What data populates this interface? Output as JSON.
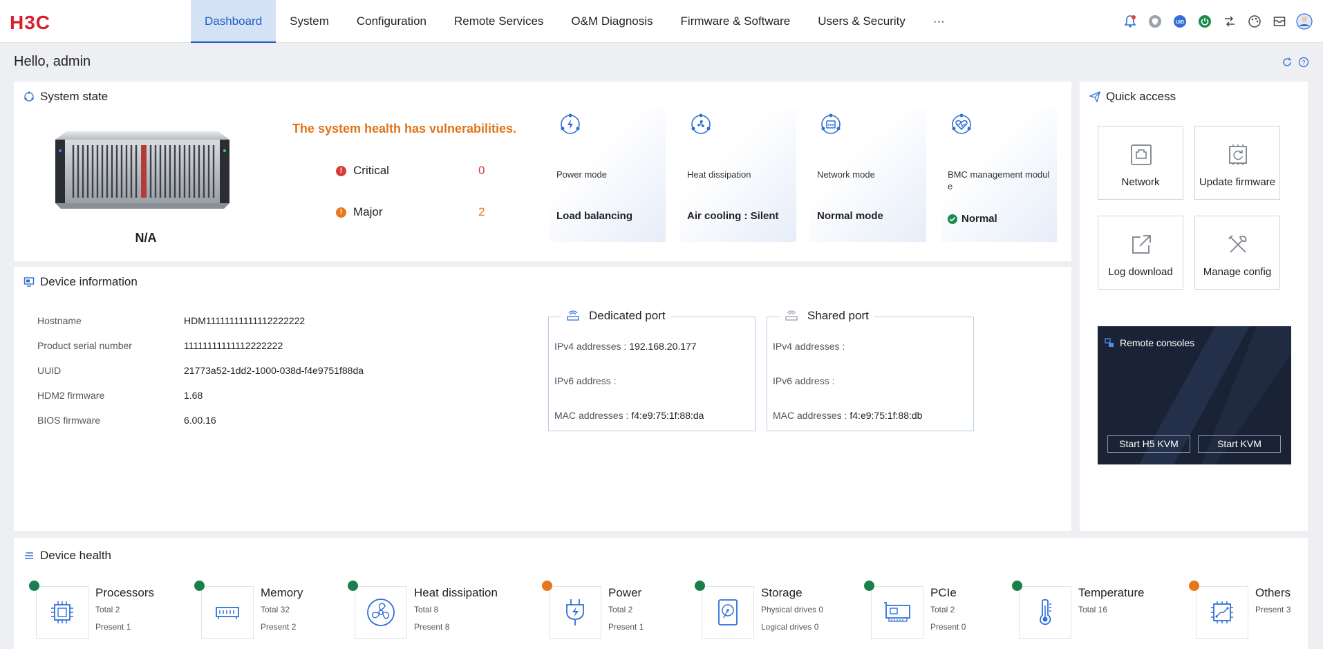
{
  "brand": {
    "logo_text": "H3C",
    "logo_color": "#d81e2c"
  },
  "nav": {
    "items": [
      {
        "label": "Dashboard",
        "active": true
      },
      {
        "label": "System"
      },
      {
        "label": "Configuration"
      },
      {
        "label": "Remote Services"
      },
      {
        "label": "O&M Diagnosis"
      },
      {
        "label": "Firmware & Software"
      },
      {
        "label": "Users & Security"
      },
      {
        "label": "···"
      }
    ],
    "icons": [
      "alarm-bell-icon",
      "security-shield-icon",
      "uid-icon",
      "power-icon",
      "network-switch-icon",
      "theme-palette-icon",
      "mail-icon",
      "user-avatar-icon"
    ],
    "uid_text": "UID"
  },
  "greeting": "Hello, admin",
  "system_state": {
    "title": "System state",
    "server_name": "N/A",
    "health_message": "The system health has vulnerabilities.",
    "critical_label": "Critical",
    "critical_count": "0",
    "major_label": "Major",
    "major_count": "2",
    "cards": [
      {
        "label": "Power mode",
        "value": "Load balancing"
      },
      {
        "label": "Heat dissipation",
        "value": "Air cooling : Silent"
      },
      {
        "label": "Network mode",
        "value": "Normal mode"
      },
      {
        "label": "BMC management module",
        "value": "Normal"
      }
    ]
  },
  "quick_access": {
    "title": "Quick access",
    "buttons": [
      "Network",
      "Update firmware",
      "Log download",
      "Manage config"
    ],
    "remote": {
      "title": "Remote consoles",
      "h5_kvm": "Start H5 KVM",
      "kvm": "Start KVM"
    }
  },
  "device_info": {
    "title": "Device information",
    "rows": [
      {
        "key": "Hostname",
        "value": "HDM11111111111112222222"
      },
      {
        "key": "Product serial number",
        "value": "11111111111112222222"
      },
      {
        "key": "UUID",
        "value": "21773a52-1dd2-1000-038d-f4e9751f88da"
      },
      {
        "key": "HDM2 firmware",
        "value": "1.68"
      },
      {
        "key": "BIOS firmware",
        "value": "6.00.16"
      }
    ],
    "dedicated": {
      "title": "Dedicated port",
      "ipv4_label": "IPv4 addresses :",
      "ipv4": "192.168.20.177",
      "ipv6_label": "IPv6 address :",
      "ipv6": "",
      "mac_label": "MAC addresses :",
      "mac": "f4:e9:75:1f:88:da"
    },
    "shared": {
      "title": "Shared port",
      "ipv4_label": "IPv4 addresses :",
      "ipv4": "",
      "ipv6_label": "IPv6 address :",
      "ipv6": "",
      "mac_label": "MAC addresses :",
      "mac": "f4:e9:75:1f:88:db"
    }
  },
  "device_health": {
    "title": "Device health",
    "items": [
      {
        "name": "Processors",
        "line1": "Total 2",
        "line2": "Present 1",
        "status": "normal"
      },
      {
        "name": "Memory",
        "line1": "Total 32",
        "line2": "Present 2",
        "status": "normal"
      },
      {
        "name": "Heat dissipation",
        "line1": "Total 8",
        "line2": "Present 8",
        "status": "normal"
      },
      {
        "name": "Power",
        "line1": "Total 2",
        "line2": "Present 1",
        "status": "major"
      },
      {
        "name": "Storage",
        "line1": "Physical drives 0",
        "line2": "Logical drives 0",
        "status": "normal"
      },
      {
        "name": "PCIe",
        "line1": "Total 2",
        "line2": "Present 0",
        "status": "normal"
      },
      {
        "name": "Temperature",
        "line1": "Total 16",
        "line2": "",
        "status": "normal"
      },
      {
        "name": "Others",
        "line1": "Present 3",
        "line2": "",
        "status": "major"
      }
    ]
  },
  "colors": {
    "accent": "#1f5cc4",
    "normal": "#1a7f4b",
    "major": "#e8761a",
    "critical": "#d93a3a",
    "warning_text": "#e17419"
  }
}
